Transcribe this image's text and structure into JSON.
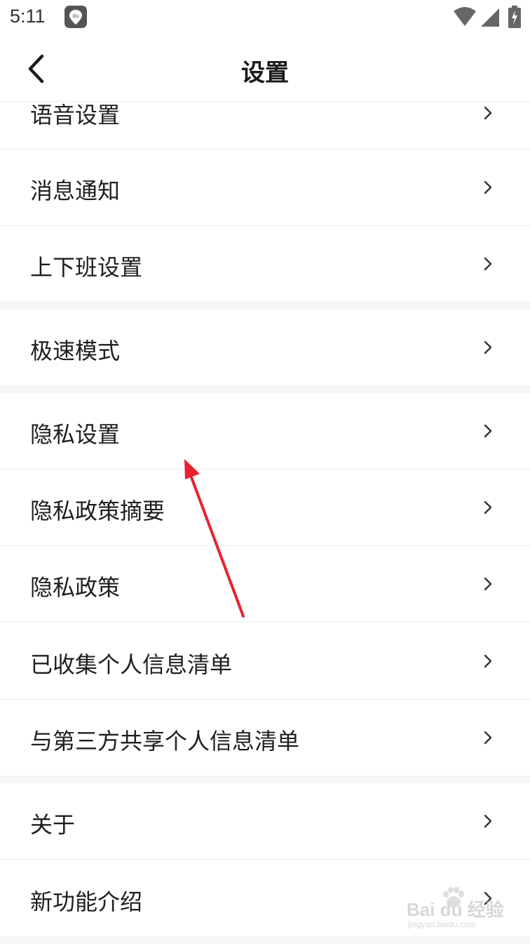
{
  "status_bar": {
    "time": "5:11",
    "du_icon_text": "du",
    "icons": [
      "du-app-icon",
      "wifi-icon",
      "signal-icon",
      "battery-charging-icon"
    ]
  },
  "header": {
    "title": "设置",
    "back_icon": "chevron-left-icon"
  },
  "settings": {
    "items": [
      {
        "label": "语音设置"
      },
      {
        "label": "消息通知"
      },
      {
        "label": "上下班设置"
      },
      {
        "label": "极速模式"
      },
      {
        "label": "隐私设置"
      },
      {
        "label": "隐私政策摘要"
      },
      {
        "label": "隐私政策"
      },
      {
        "label": "已收集个人信息清单"
      },
      {
        "label": "与第三方共享个人信息清单"
      },
      {
        "label": "关于"
      },
      {
        "label": "新功能介绍"
      }
    ]
  },
  "annotation": {
    "type": "red-arrow",
    "color": "#e8222f",
    "points_to": "隐私设置"
  },
  "watermark": {
    "brand": "Bai du 经验",
    "url": "jingyan.baidu.com"
  }
}
